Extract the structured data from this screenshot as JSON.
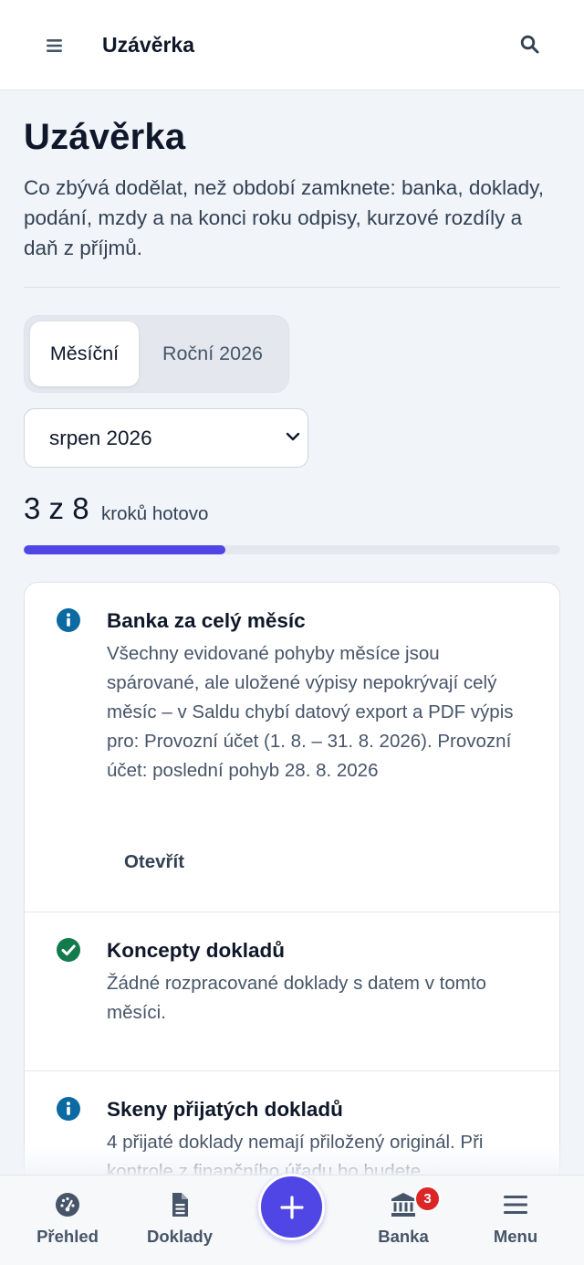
{
  "header": {
    "title": "Uzávěrka"
  },
  "page": {
    "title": "Uzávěrka",
    "description": "Co zbývá dodělat, než období zamknete: banka, doklady, podání, mzdy a na konci roku odpisy, kurzové rozdíly a daň z příjmů."
  },
  "tabs": [
    {
      "label": "Měsíční",
      "active": true
    },
    {
      "label": "Roční 2026",
      "active": false
    }
  ],
  "period_select": {
    "value": "srpen 2026"
  },
  "progress": {
    "count_text": "3 z 8",
    "label": "kroků hotovo",
    "done": 3,
    "total": 8
  },
  "steps": [
    {
      "status": "info",
      "title": "Banka za celý měsíc",
      "description": "Všechny evidované pohyby měsíce jsou spárované, ale uložené výpisy nepokrývají celý měsíc – v Saldu chybí datový export a PDF výpis pro: Provozní účet (1. 8. – 31. 8. 2026). Provozní účet: poslední pohyb 28. 8. 2026",
      "action": "Otevřít"
    },
    {
      "status": "done",
      "title": "Koncepty dokladů",
      "description": "Žádné rozpracované doklady s datem v tomto měsíci."
    },
    {
      "status": "info",
      "title": "Skeny přijatých dokladů",
      "description": "4 přijaté doklady nemají přiložený originál. Při kontrole z finančního úřadu ho budete"
    }
  ],
  "bottom_nav": {
    "items": [
      {
        "label": "Přehled",
        "icon": "gauge-icon"
      },
      {
        "label": "Doklady",
        "icon": "document-icon"
      },
      {
        "label": "Banka",
        "icon": "bank-icon",
        "badge": "3"
      },
      {
        "label": "Menu",
        "icon": "menu-icon"
      }
    ],
    "fab_icon": "plus-icon"
  },
  "colors": {
    "accent": "#4f46e5",
    "info": "#0b6aa2",
    "success": "#137a4b",
    "badge": "#dc2626",
    "text": "#0f172a",
    "muted": "#475569",
    "background": "#f1f4f8"
  }
}
